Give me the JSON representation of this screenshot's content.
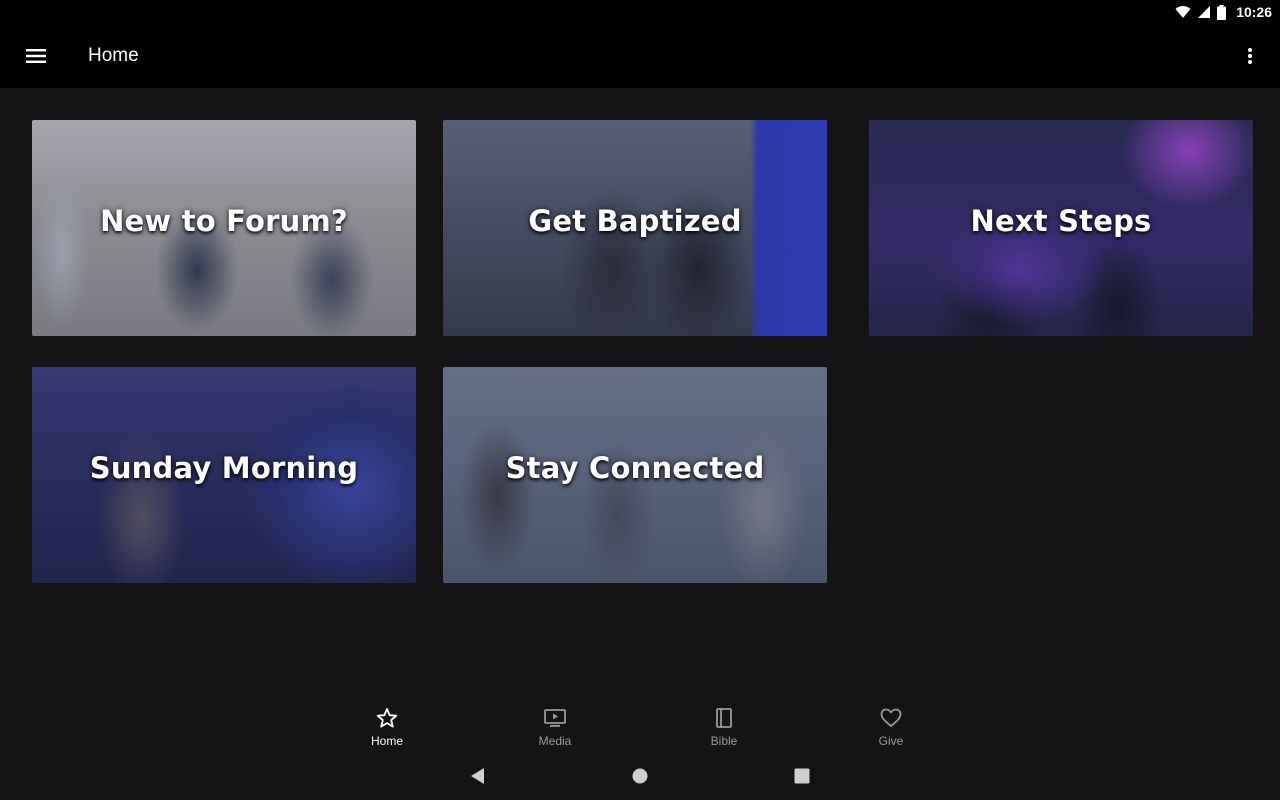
{
  "status_bar": {
    "time": "10:26",
    "icons": [
      "wifi-icon",
      "signal-icon",
      "battery-icon"
    ]
  },
  "app_bar": {
    "title": "Home",
    "menu_icon": "hamburger-menu-icon",
    "overflow_icon": "more-vert-icon"
  },
  "cards": [
    {
      "label": "New to Forum?"
    },
    {
      "label": "Get Baptized"
    },
    {
      "label": "Next Steps"
    },
    {
      "label": "Sunday Morning"
    },
    {
      "label": "Stay Connected"
    }
  ],
  "bottom_nav": {
    "items": [
      {
        "label": "Home",
        "icon": "star-icon",
        "active": true
      },
      {
        "label": "Media",
        "icon": "play-screen-icon",
        "active": false
      },
      {
        "label": "Bible",
        "icon": "book-icon",
        "active": false
      },
      {
        "label": "Give",
        "icon": "heart-icon",
        "active": false
      }
    ]
  },
  "system_nav": {
    "icons": [
      "back-icon",
      "home-circle-icon",
      "recents-icon"
    ]
  },
  "colors": {
    "background": "#141416",
    "bar": "#000000",
    "nav_active": "#ffffff",
    "nav_inactive": "#9a9a9e"
  }
}
